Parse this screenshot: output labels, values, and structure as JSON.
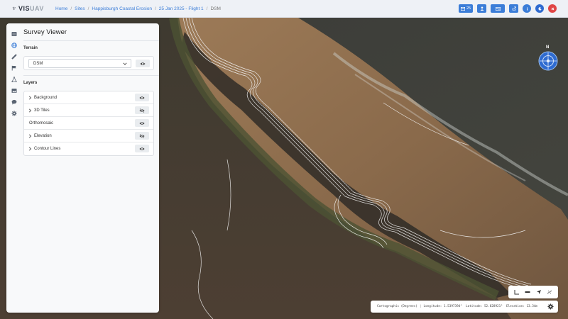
{
  "app": {
    "logo_prefix": "VIS",
    "logo_suffix": "UAV",
    "logo_mark": "♆"
  },
  "breadcrumb": [
    {
      "label": "Home"
    },
    {
      "label": "Sites"
    },
    {
      "label": "Happisburgh Coastal Erosion"
    },
    {
      "label": "25 Jan 2025 - Flight 1"
    },
    {
      "label": "DSM"
    }
  ],
  "toolbar": {
    "messages_count": "25",
    "buttons": [
      {
        "icon": "mail-icon"
      },
      {
        "icon": "user-icon"
      },
      {
        "icon": "id-card-icon"
      },
      {
        "icon": "share-icon"
      },
      {
        "icon": "info-icon"
      },
      {
        "icon": "moon-icon"
      },
      {
        "icon": "close-icon"
      }
    ]
  },
  "panel": {
    "title": "Survey Viewer",
    "rail_icons": [
      "list-icon",
      "globe-icon",
      "ruler-icon",
      "flag-icon",
      "network-icon",
      "image-icon",
      "comment-icon",
      "gear-icon"
    ],
    "terrain": {
      "label": "Terrain",
      "selected": "DSM"
    },
    "layers": {
      "label": "Layers",
      "items": [
        {
          "label": "Background",
          "expandable": true,
          "visible": true
        },
        {
          "label": "3D Tiles",
          "expandable": true,
          "visible": false
        },
        {
          "label": "Orthomosaic",
          "expandable": false,
          "visible": true
        },
        {
          "label": "Elevation",
          "expandable": true,
          "visible": false
        },
        {
          "label": "Contour Lines",
          "expandable": true,
          "visible": true
        }
      ]
    }
  },
  "map": {
    "compass_north": "N",
    "tools": [
      "corner-measure-icon",
      "line-measure-icon",
      "navigate-icon",
      "slope-icon"
    ],
    "status": {
      "projection": "Cartographic (Degrees)",
      "longitude_label": "Longitude:",
      "longitude": "1.5397394°",
      "latitude_label": "Latitude:",
      "latitude": "52.828921°",
      "elevation_label": "Elevation:",
      "elevation": "13.34m"
    }
  },
  "colors": {
    "accent": "#3b7dd8",
    "danger": "#e04646",
    "sea": "#3d3f3c",
    "sand": "#8d6e4f",
    "field": "#4a3d32"
  }
}
